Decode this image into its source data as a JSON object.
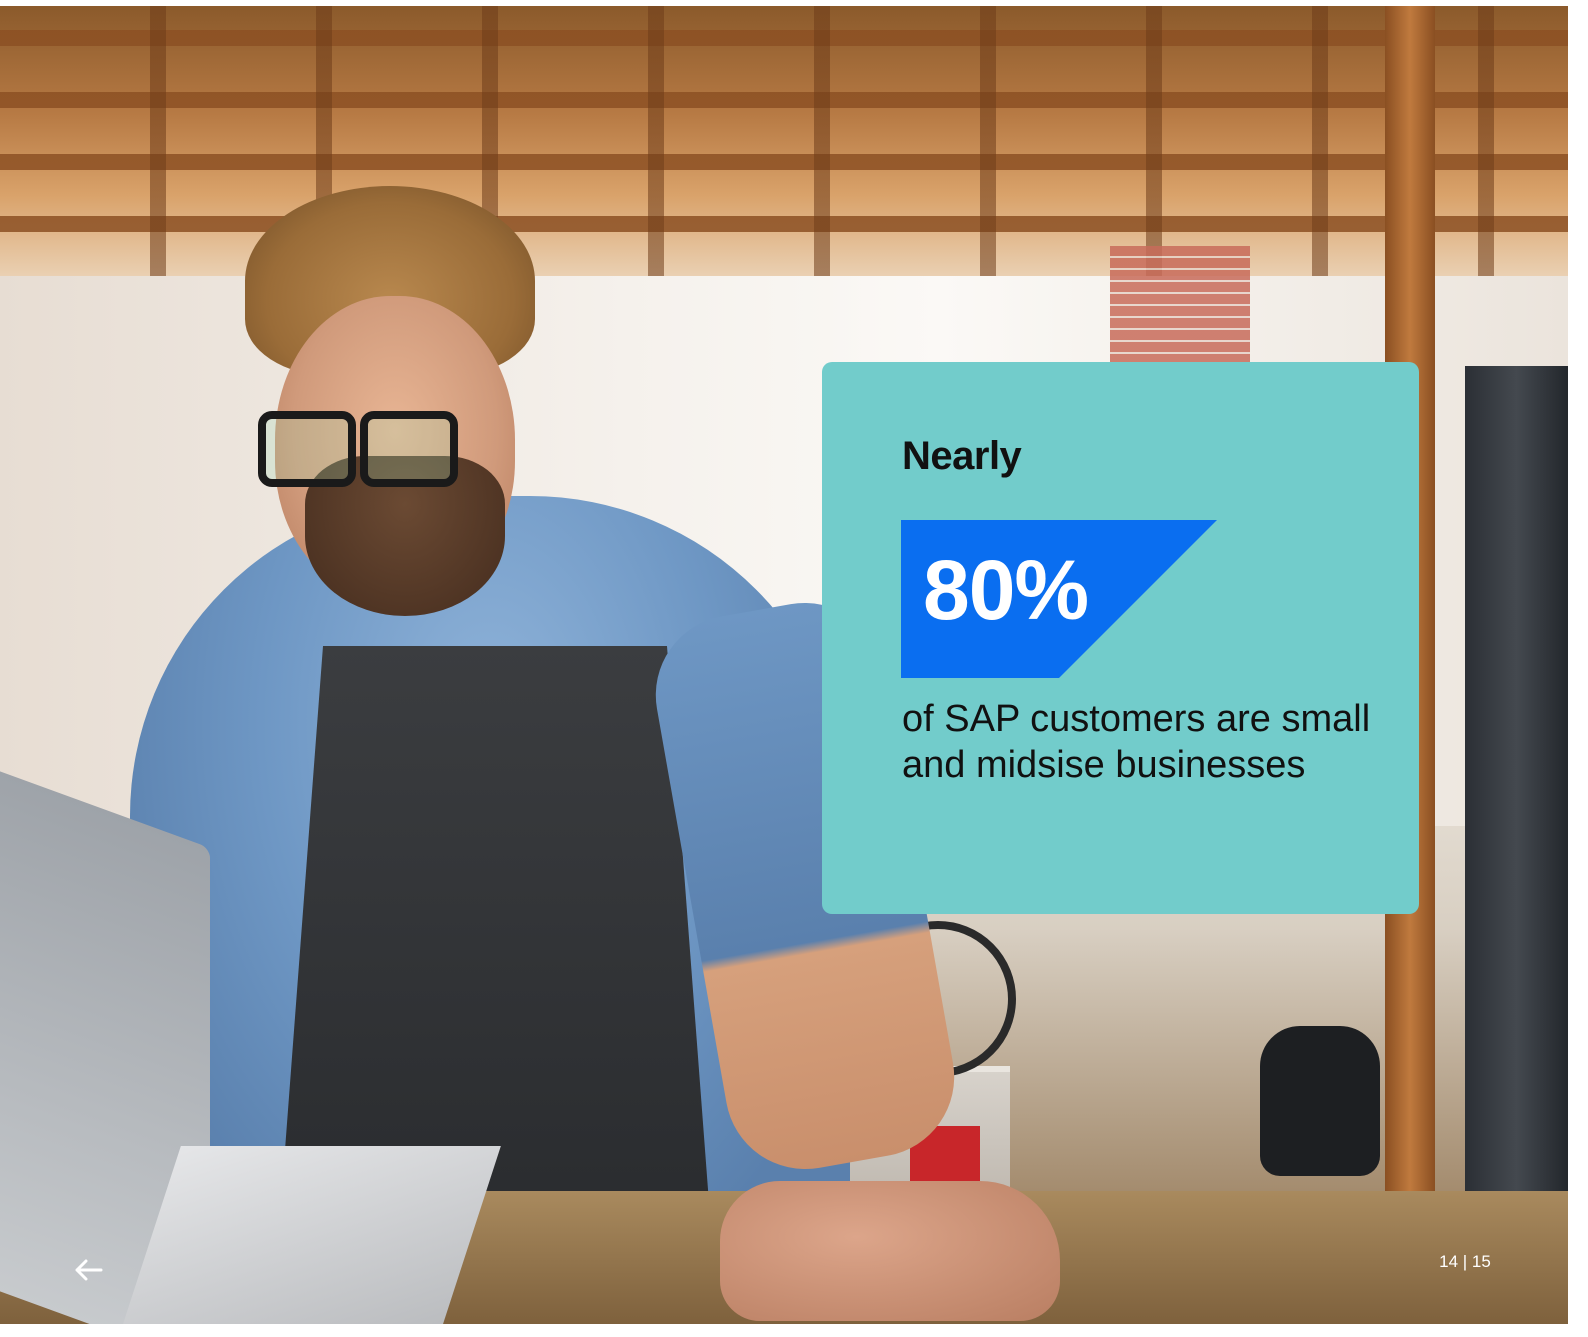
{
  "stat_card": {
    "lead": "Nearly",
    "value": "80%",
    "description": "of SAP customers are small and midsise businesses",
    "colors": {
      "card_background": "#72cccb",
      "highlight": "#0a6ef0",
      "value_text": "#ffffff",
      "text": "#111111"
    }
  },
  "navigation": {
    "back_icon": "arrow-left-icon",
    "page_indicator": "14 | 15"
  },
  "background_photo": {
    "subject": "bearded man in glasses and apron working on a laptop in a workshop"
  }
}
